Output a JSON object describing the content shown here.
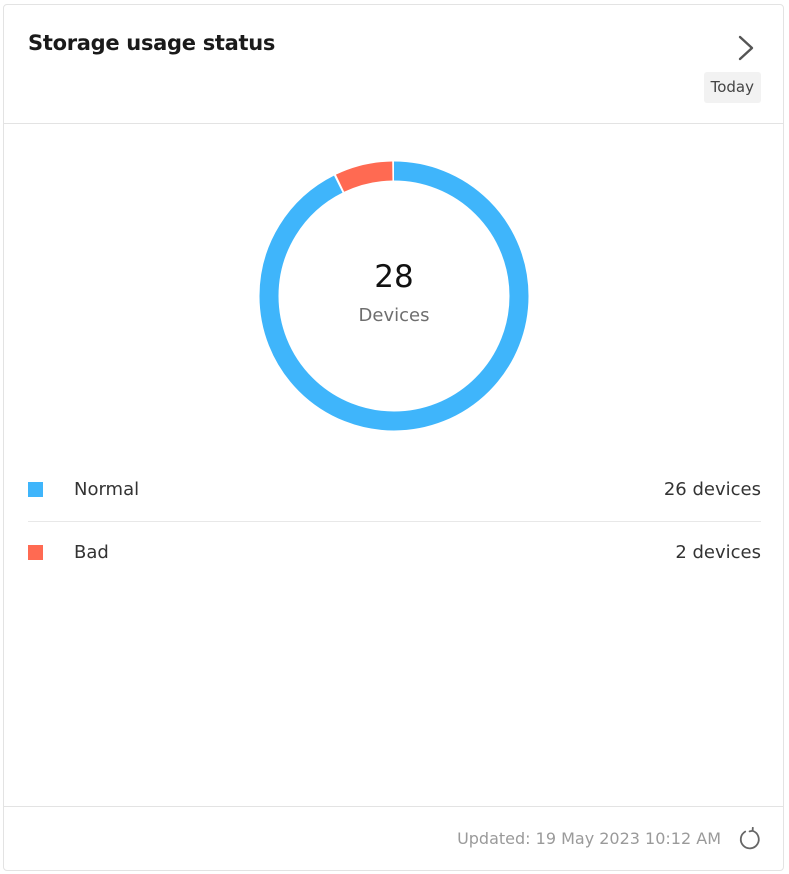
{
  "header": {
    "title": "Storage usage status",
    "period": "Today",
    "next_icon": "chevron-right-icon"
  },
  "chart_data": {
    "type": "pie",
    "variant": "donut",
    "center_value": "28",
    "center_label": "Devices",
    "categories": [
      "Normal",
      "Bad"
    ],
    "values": [
      26,
      2
    ],
    "colors": [
      "#3fb5fb",
      "#ff6a52"
    ]
  },
  "legend": {
    "items": [
      {
        "label": "Normal",
        "value": "26 devices",
        "color": "#3fb5fb"
      },
      {
        "label": "Bad",
        "value": "2 devices",
        "color": "#ff6a52"
      }
    ]
  },
  "footer": {
    "updated": "Updated: 19 May 2023 10:12 AM",
    "refresh_icon": "refresh-icon"
  }
}
